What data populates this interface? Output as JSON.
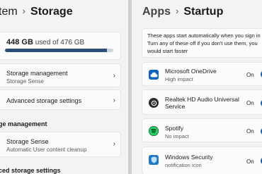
{
  "left": {
    "breadcrumb_parent": "tem",
    "page_title": "Storage",
    "usage": {
      "used": "448 GB",
      "rest": "used of 476 GB",
      "fraction_used": 0.94
    },
    "items": [
      {
        "title": "Storage management",
        "subtitle": "Storage Sense"
      },
      {
        "title": "Advanced storage settings",
        "subtitle": ""
      }
    ],
    "section_management": "ge management",
    "storage_sense": {
      "title": "Storage Sense",
      "subtitle": "Automatic User content cleanup"
    },
    "section_advanced": "ced storage settings"
  },
  "right": {
    "breadcrumb_parent": "Apps",
    "page_title": "Startup",
    "intro_lines": [
      "These apps start automatically when you sign in",
      "Turn any of these off if you don't use them, you",
      "would start faster"
    ],
    "apps": [
      {
        "name": "Microsoft OneDrive",
        "name2": "",
        "impact": "High impact",
        "state": "On",
        "icon": "onedrive-cloud-icon",
        "icon_bg": "#0a64c7"
      },
      {
        "name": "Realtek HD Audio Universal",
        "name2": "Service",
        "impact": "",
        "state": "On",
        "icon": "realtek-audio-icon",
        "icon_bg": "#2b2b2b"
      },
      {
        "name": "Spotify",
        "name2": "",
        "impact": "No impact",
        "state": "On",
        "icon": "spotify-icon",
        "icon_bg": "#1ed760"
      },
      {
        "name": "Windows Security",
        "name2": "",
        "impact": "notification icon",
        "state": "On",
        "icon": "windows-security-shield-icon",
        "icon_bg": "#1f78c8"
      }
    ]
  },
  "colors": {
    "accent": "#1d61b3",
    "bar_fill": "#2c4f7a",
    "background": "#f3f3f3"
  }
}
